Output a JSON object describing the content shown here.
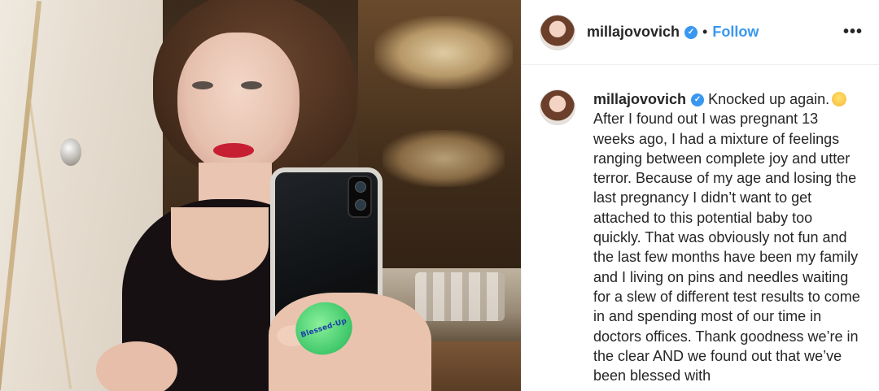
{
  "post": {
    "image": {
      "popsocket_text": "Blessed-Up",
      "colors": {
        "dress": "#161012",
        "lips": "#c61f34",
        "popsocket": "#3fc76a"
      }
    },
    "header": {
      "username": "millajovovich",
      "separator": "•",
      "follow_label": "Follow",
      "more_icon": "•••"
    },
    "caption": {
      "username": "millajovovich",
      "text_lines": [
        "Knocked up again.",
        "After I found out I was pregnant 13 weeks ago, I had a mixture of feelings ranging between complete joy and utter terror. Because of my age and losing the last pregnancy I didn’t want to get attached to this potential baby too quickly. That was obviously not fun and the last few months have been my family and I living on pins and needles waiting for a slew of different test results to come in and spending most of our time in doctors offices. Thank goodness we’re in the clear AND we found out that we’ve been blessed with"
      ]
    },
    "colors": {
      "accent": "#3897f0",
      "text": "#262626",
      "border": "#efefef"
    }
  }
}
